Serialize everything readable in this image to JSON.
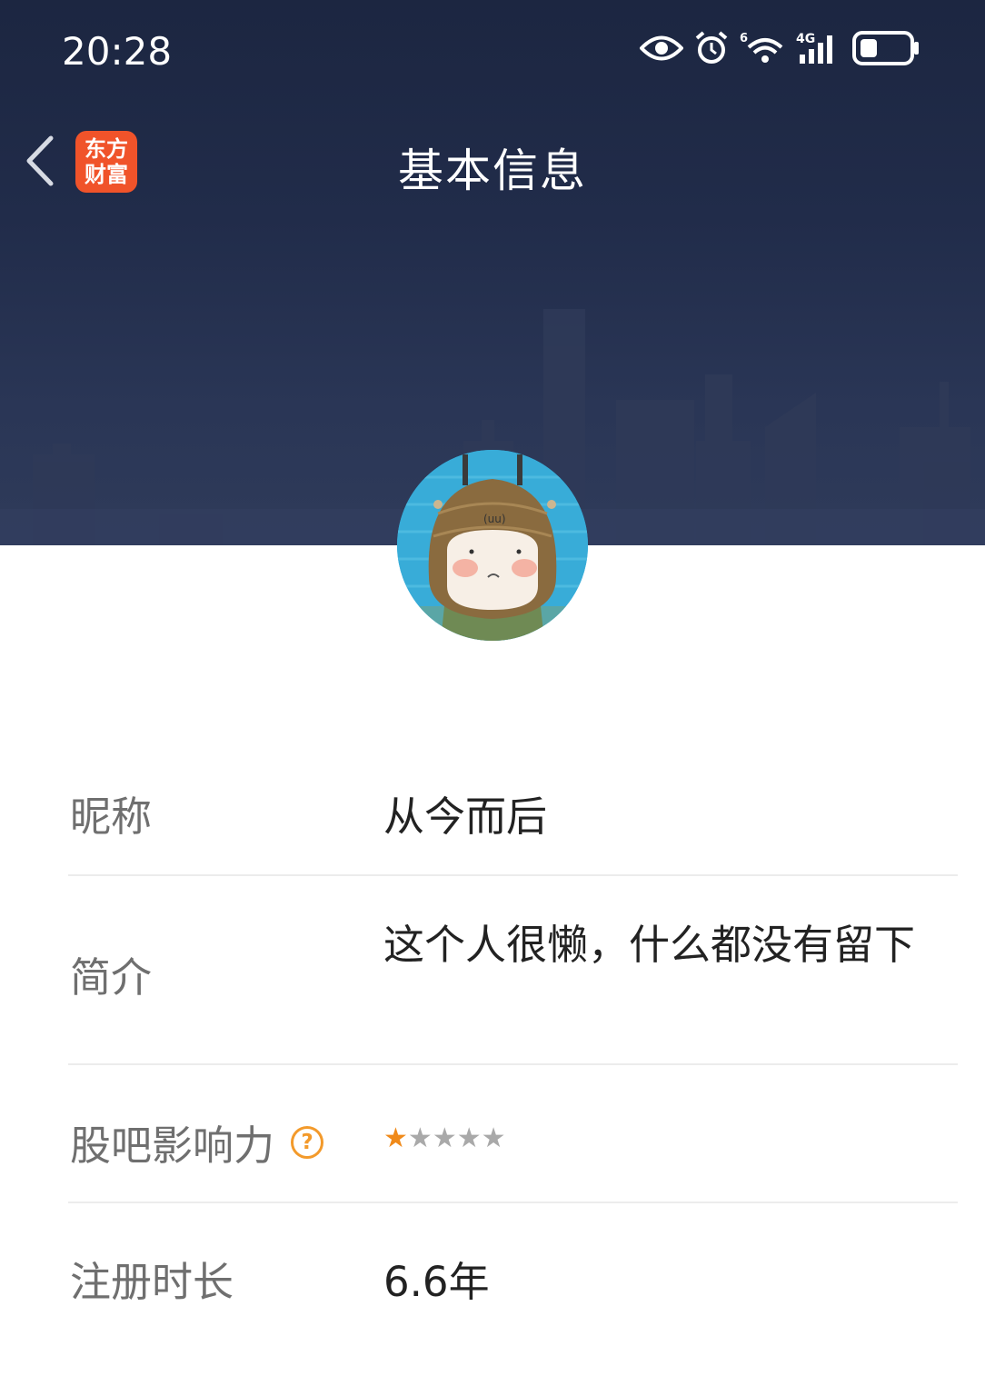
{
  "status_bar": {
    "time": "20:28",
    "icons": [
      "eye-icon",
      "alarm-icon",
      "wifi-6-icon",
      "signal-4g-icon",
      "battery-icon"
    ],
    "wifi_label": "6",
    "network_label": "4G"
  },
  "nav": {
    "back_icon": "chevron-left-icon",
    "logo_line1": "东方",
    "logo_line2": "财富",
    "title": "基本信息"
  },
  "colors": {
    "header_bg": "#212c4a",
    "logo_bg": "#f0532a",
    "accent_orange": "#f39a2b",
    "star_on": "#f08a1a",
    "star_off": "#a9a9a9",
    "label_text": "#6f6f6f",
    "value_text": "#222222"
  },
  "profile": {
    "nickname_label": "昵称",
    "nickname": "从今而后",
    "intro_label": "简介",
    "intro": "这个人很懒，什么都没有留下",
    "influence_label": "股吧影响力",
    "influence_help": "?",
    "influence_rating": 1,
    "influence_max": 5,
    "register_label": "注册时长",
    "register_value": "6.6年"
  }
}
